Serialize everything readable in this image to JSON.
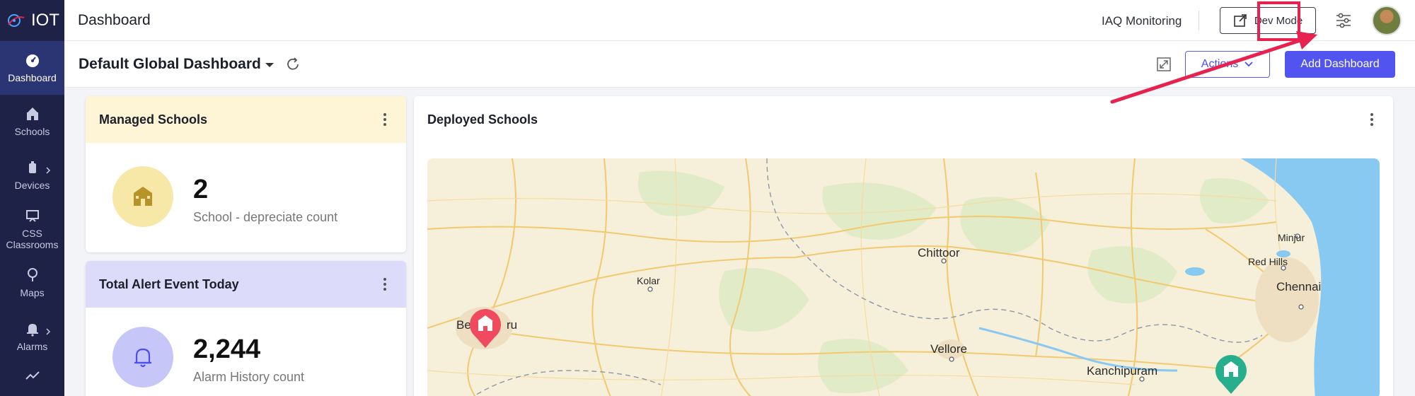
{
  "sidebar": {
    "brand": "IOT",
    "items": [
      {
        "label": "Dashboard",
        "icon": "dashboard-icon",
        "active": true
      },
      {
        "label": "Schools",
        "icon": "school-icon"
      },
      {
        "label": "Devices",
        "icon": "device-icon"
      },
      {
        "label": "CSS Classrooms",
        "icon": "classroom-icon"
      },
      {
        "label": "Maps",
        "icon": "map-pin-icon"
      },
      {
        "label": "Alarms",
        "icon": "bell-icon"
      }
    ]
  },
  "header": {
    "title": "Dashboard",
    "project": "IAQ Monitoring",
    "dev_mode_label": "Dev Mode",
    "settings_icon": "sliders-icon",
    "highlight_color": "#e8224e"
  },
  "subheader": {
    "dashboard_name": "Default Global Dashboard",
    "actions_label": "Actions",
    "add_dashboard_label": "Add Dashboard"
  },
  "cards": {
    "managed_schools": {
      "title": "Managed Schools",
      "value": "2",
      "label": "School - depreciate count",
      "header_color": "#fdf5d5"
    },
    "total_alerts": {
      "title": "Total Alert Event Today",
      "value": "2,244",
      "label": "Alarm History count",
      "header_color": "#dcdcfa"
    },
    "deployed_schools": {
      "title": "Deployed Schools",
      "places": {
        "chittoor": "Chittoor",
        "kolar": "Kolar",
        "minjur": "Minjur",
        "red_hills": "Red Hills",
        "chennai": "Chennai",
        "vellore": "Vellore",
        "kanchipuram": "Kanchipuram",
        "bengaluru_left": "Be",
        "bengaluru_right": "ru"
      }
    }
  }
}
